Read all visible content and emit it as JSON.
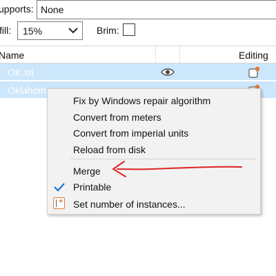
{
  "settings": {
    "supports_label": "upports:",
    "supports_value": "None",
    "infill_label": "fill:",
    "infill_value": "15%",
    "brim_label": "Brim:",
    "brim_checked": false
  },
  "list": {
    "header_name": "Name",
    "header_editing": "Editing",
    "rows": [
      {
        "name": "OK.stl",
        "icon": "eye-icon",
        "edit_icon": "editing-icon"
      },
      {
        "name": "Oklahom",
        "icon": "eye-icon",
        "edit_icon": "editing-icon"
      }
    ]
  },
  "context_menu": {
    "items": [
      {
        "label": "Fix by Windows repair algorithm"
      },
      {
        "label": "Convert from meters"
      },
      {
        "label": "Convert from imperial units"
      },
      {
        "label": "Reload from disk"
      },
      {
        "label": "Merge"
      },
      {
        "label": "Printable",
        "checked": true,
        "icon": "checkmark-icon"
      },
      {
        "label": "Set number of instances...",
        "icon": "instances-icon"
      }
    ]
  },
  "colors": {
    "selection": "#cce6fb",
    "checkmark": "#1e6fd9",
    "annotation": "#e02020",
    "accent_orange": "#e07b39"
  }
}
